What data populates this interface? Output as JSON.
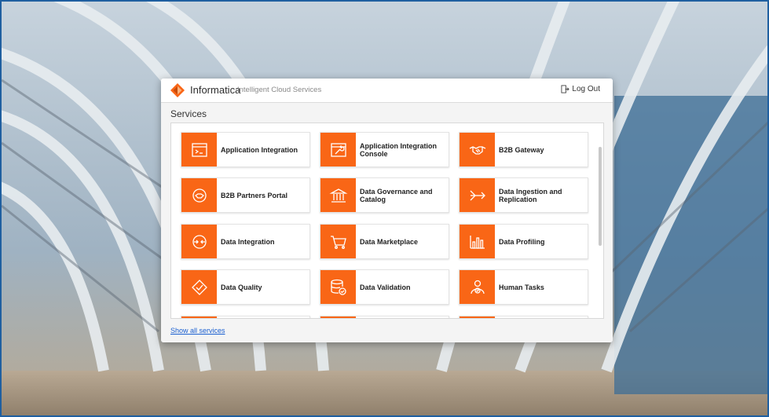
{
  "header": {
    "brand": "Informatica",
    "tagline": "Intelligent Cloud Services",
    "logout_label": "Log Out"
  },
  "services": {
    "title": "Services",
    "show_all_label": "Show all services",
    "items": [
      {
        "label": "Application Integration",
        "icon": "application-window-icon"
      },
      {
        "label": "Application Integration Console",
        "icon": "wrench-window-icon"
      },
      {
        "label": "B2B Gateway",
        "icon": "handshake-icon"
      },
      {
        "label": "B2B Partners Portal",
        "icon": "partners-circle-icon"
      },
      {
        "label": "Data Governance and Catalog",
        "icon": "bank-building-icon"
      },
      {
        "label": "Data Ingestion and Replication",
        "icon": "funnel-arrows-icon"
      },
      {
        "label": "Data Integration",
        "icon": "converge-arrows-icon"
      },
      {
        "label": "Data Marketplace",
        "icon": "shopping-cart-icon"
      },
      {
        "label": "Data Profiling",
        "icon": "bar-chart-icon"
      },
      {
        "label": "Data Quality",
        "icon": "diamond-check-icon"
      },
      {
        "label": "Data Validation",
        "icon": "database-check-icon"
      },
      {
        "label": "Human Tasks",
        "icon": "person-check-icon"
      }
    ]
  },
  "colors": {
    "accent": "#f96616",
    "link": "#1a5fd0"
  }
}
